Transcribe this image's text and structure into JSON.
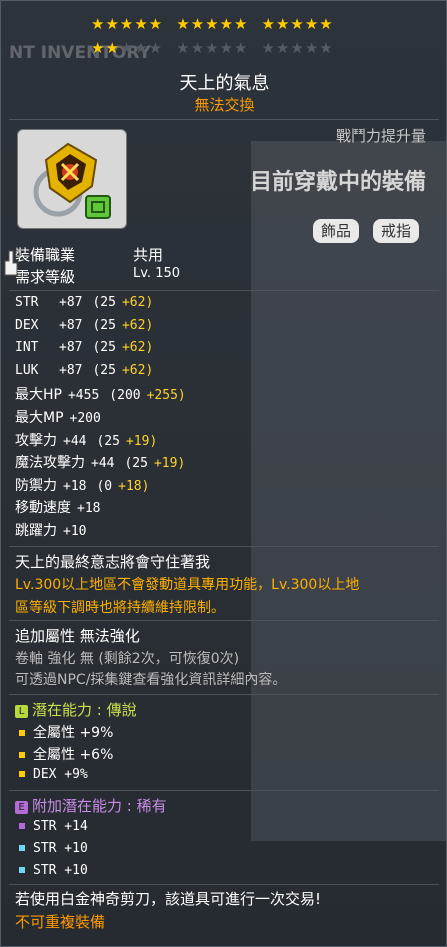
{
  "header": {
    "bg_text": "NT INVENTORY"
  },
  "stars": {
    "filled": 17,
    "total": 30
  },
  "item": {
    "name": "天上的氣息",
    "trade": "無法交換",
    "power_label": "戰鬥力提升量",
    "equipped": "目前穿戴中的裝備",
    "tags": [
      "飾品",
      "戒指"
    ]
  },
  "req": {
    "job_label": "裝備職業",
    "job_value": "共用",
    "level_label": "需求等級",
    "level_value": "Lv. 150"
  },
  "stats": [
    {
      "name": "STR",
      "total": "+87",
      "base": "(25",
      "bonus": "+62)"
    },
    {
      "name": "DEX",
      "total": "+87",
      "base": "(25",
      "bonus": "+62)"
    },
    {
      "name": "INT",
      "total": "+87",
      "base": "(25",
      "bonus": "+62)"
    },
    {
      "name": "LUK",
      "total": "+87",
      "base": "(25",
      "bonus": "+62)"
    },
    {
      "name": "最大HP",
      "total": "+455",
      "base": "(200",
      "bonus": "+255)"
    },
    {
      "name": "最大MP",
      "total": "+200",
      "base": "",
      "bonus": ""
    },
    {
      "name": "攻擊力",
      "total": "+44",
      "base": "(25",
      "bonus": "+19)"
    },
    {
      "name": "魔法攻擊力",
      "total": "+44",
      "base": "(25",
      "bonus": "+19)"
    },
    {
      "name": "防禦力",
      "total": "+18",
      "base": "(0",
      "bonus": "+18)"
    },
    {
      "name": "移動速度",
      "total": "+18",
      "base": "",
      "bonus": ""
    },
    {
      "name": "跳躍力",
      "total": "+10",
      "base": "",
      "bonus": ""
    }
  ],
  "desc": {
    "line1": "天上的最終意志將會守住著我",
    "line2": "Lv.300以上地區不會發動道具專用功能，Lv.300以上地",
    "line3": "區等級下調時也將持續維持限制。"
  },
  "enhance": {
    "line1": "追加屬性 無法強化",
    "line2": "卷軸 強化 無 (剩餘2次，可恢復0次)",
    "line3": "可透過NPC/採集鍵查看強化資訊詳細內容。"
  },
  "potential": {
    "badge": "L",
    "title": "潛在能力 : 傳說",
    "lines": [
      "全屬性 +9%",
      "全屬性 +6%",
      "DEX +9%"
    ]
  },
  "additional": {
    "badge": "E",
    "title": "附加潛在能力 : 稀有",
    "lines": [
      "STR +14",
      "STR +10",
      "STR +10"
    ]
  },
  "footer": {
    "line1": "若使用白金神奇剪刀，該道具可進行一次交易!",
    "line2": "不可重複裝備"
  },
  "colors": {
    "legend": "#b6d93c",
    "epic": "#b36bd6",
    "rare": "#6fd7ef",
    "gold": "#ffcc00",
    "orange": "#ff9900"
  }
}
